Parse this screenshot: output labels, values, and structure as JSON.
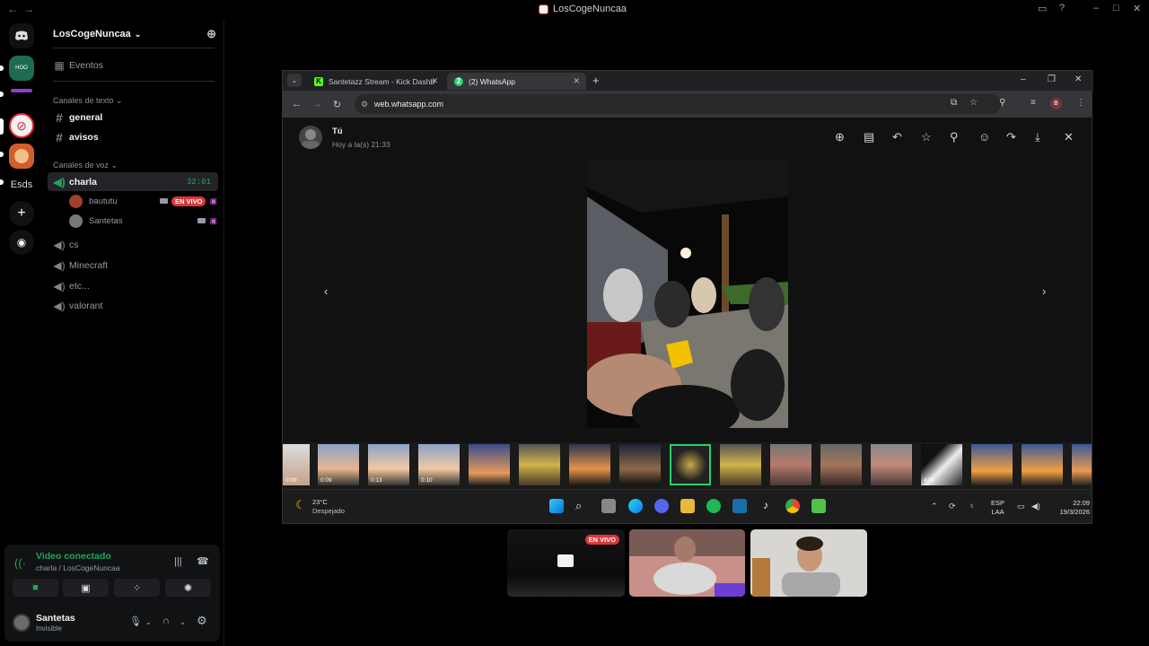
{
  "titlebar": {
    "title": "LosCogeNuncaa"
  },
  "servers": [
    {
      "label": "",
      "icon": "discord-icon"
    },
    {
      "label": "Esds"
    }
  ],
  "channel_list": {
    "server_name": "LosCogeNuncaa",
    "events_label": "Eventos",
    "text_category": "Canales de texto",
    "text_channels": [
      "general",
      "avisos"
    ],
    "voice_category": "Canales de voz",
    "voice_channels": [
      {
        "name": "charla",
        "timer": "32:01",
        "active": true
      },
      {
        "name": "cs"
      },
      {
        "name": "Minecraft"
      },
      {
        "name": "etc..."
      },
      {
        "name": "valorant"
      }
    ],
    "voice_users": [
      {
        "name": "baututu",
        "live": "EN VIVO"
      },
      {
        "name": "Santetas"
      }
    ]
  },
  "voice_panel": {
    "status": "Video conectado",
    "location": "charla / LosCogeNuncaa",
    "user_name": "Santetas",
    "user_status": "Invisible"
  },
  "browser": {
    "tabs": [
      {
        "label": "Santetazz Stream - Kick Dashb",
        "active": false
      },
      {
        "label": "(2) WhatsApp",
        "active": true
      }
    ],
    "url": "web.whatsapp.com"
  },
  "whatsapp": {
    "sender": "Tú",
    "time": "Hoy a la(s) 21:33",
    "thumbs_durations": [
      "0:09",
      "0:09",
      "0:13",
      "0:10",
      "4:01"
    ]
  },
  "taskbar": {
    "temp": "23°C",
    "weather": "Despejado",
    "lang1": "ESP",
    "lang2": "LAA",
    "time": "22:09",
    "date": "19/3/2026"
  },
  "stream_tiles": {
    "live_label": "EN VIVO"
  },
  "colors": {
    "accent_green": "#23a55a",
    "live_red": "#da373c",
    "wa_green": "#25d366"
  }
}
